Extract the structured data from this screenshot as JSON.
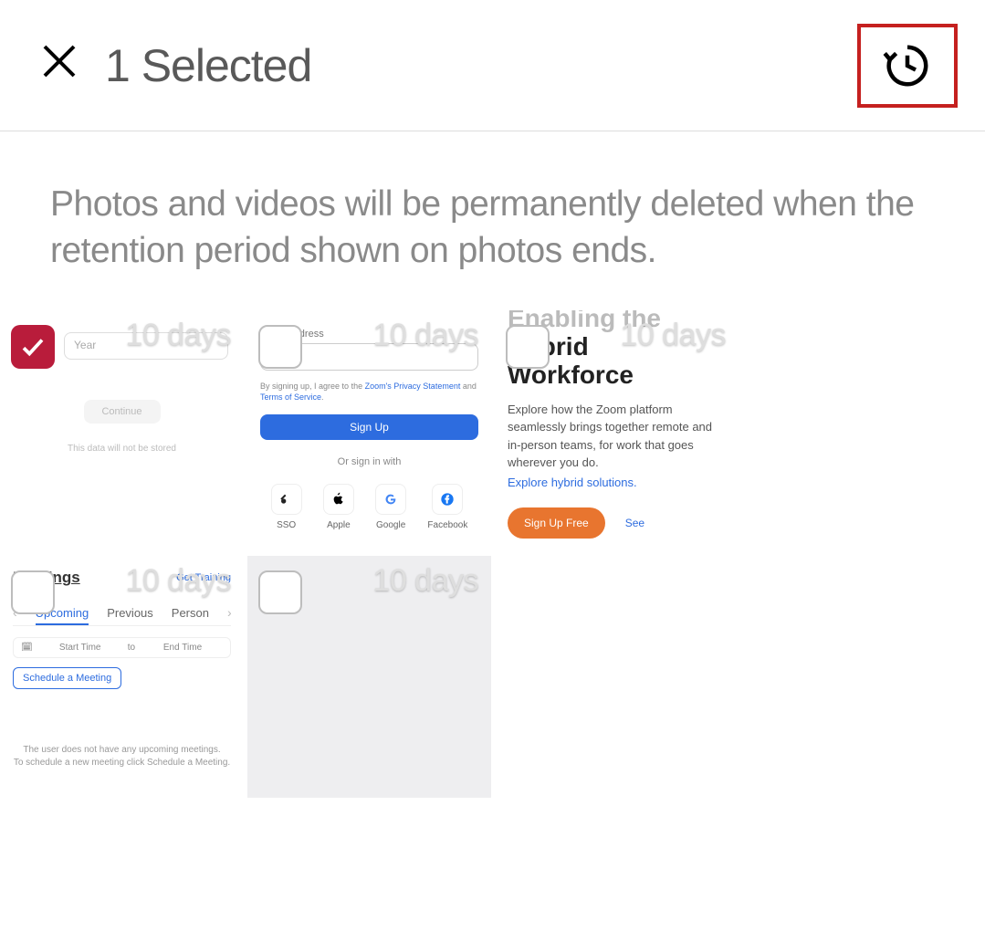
{
  "header": {
    "title": "1 Selected"
  },
  "warning": "Photos and videos will be permanently deleted when the retention period shown on photos ends.",
  "retention_label": "10 days",
  "thumbs": {
    "t1": {
      "year_placeholder": "Year",
      "continue": "Continue",
      "nostore": "This data will not be stored"
    },
    "t2": {
      "email_label": "Email address",
      "agree_pre": "By signing up, I agree to the ",
      "privacy": "Zoom's Privacy Statement",
      "agree_mid": " and ",
      "terms": "Terms of Service",
      "signup": "Sign Up",
      "or": "Or sign in with",
      "providers": [
        "SSO",
        "Apple",
        "Google",
        "Facebook"
      ]
    },
    "t3": {
      "heading_line1": "Enabling the",
      "heading_line2": "Hybrid",
      "heading_line3": "Workforce",
      "body": "Explore how the Zoom platform seamlessly brings together remote and in-person teams, for work that goes wherever you do.",
      "link": "Explore hybrid solutions.",
      "free": "Sign Up Free",
      "see": "See"
    },
    "t4": {
      "title": "Meetings",
      "get_training": "Get Training",
      "tabs": {
        "upcoming": "Upcoming",
        "previous": "Previous",
        "personal": "Person"
      },
      "start_time": "Start Time",
      "to": "to",
      "end_time": "End Time",
      "schedule": "Schedule a Meeting",
      "empty1": "The user does not have any upcoming meetings.",
      "empty2": "To schedule a new meeting click Schedule a Meeting."
    }
  }
}
